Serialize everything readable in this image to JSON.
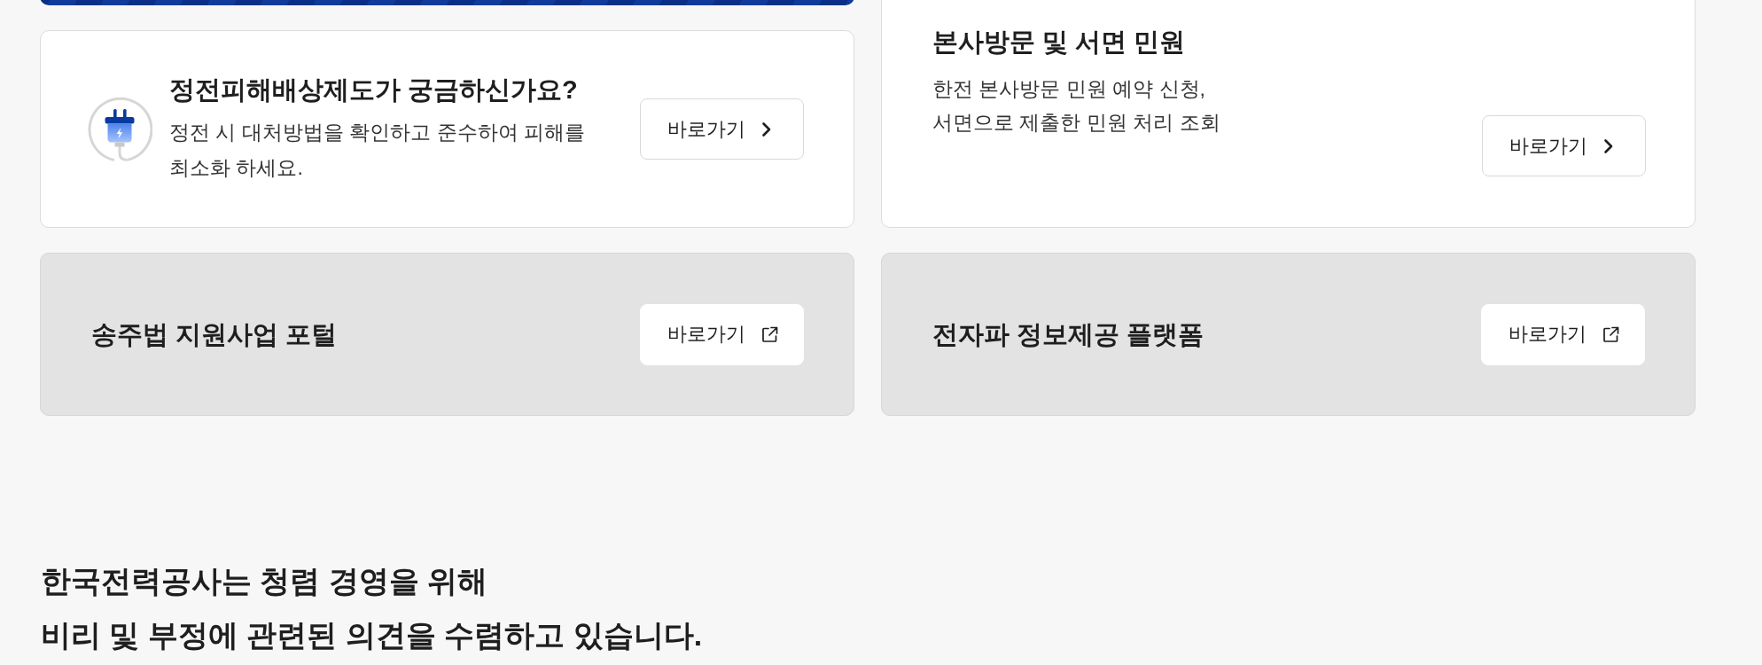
{
  "info_cards": [
    {
      "kind": "icon_info",
      "title": "정전피해배상제도가 궁금하신가요?",
      "description": "정전 시 대처방법을 확인하고 준수하여 피해를\n최소화 하세요.",
      "button": {
        "label": "바로가기",
        "opens_new_window": false
      }
    },
    {
      "kind": "text_info",
      "title": "본사방문 및 서면 민원",
      "description": "한전 본사방문 민원 예약 신청,\n서면으로 제출한 민원 처리 조회",
      "button": {
        "label": "바로가기",
        "opens_new_window": false
      }
    }
  ],
  "portal_cards": [
    {
      "title": "송주법 지원사업 포털",
      "button": {
        "label": "바로가기",
        "opens_new_window": true
      }
    },
    {
      "title": "전자파 정보제공 플랫폼",
      "button": {
        "label": "바로가기",
        "opens_new_window": true
      }
    }
  ],
  "integrity_notice": {
    "text": "한국전력공사는 청렴 경영을 위해\n비리 및 부정에 관련된 의견을 수렴하고 있습니다."
  }
}
